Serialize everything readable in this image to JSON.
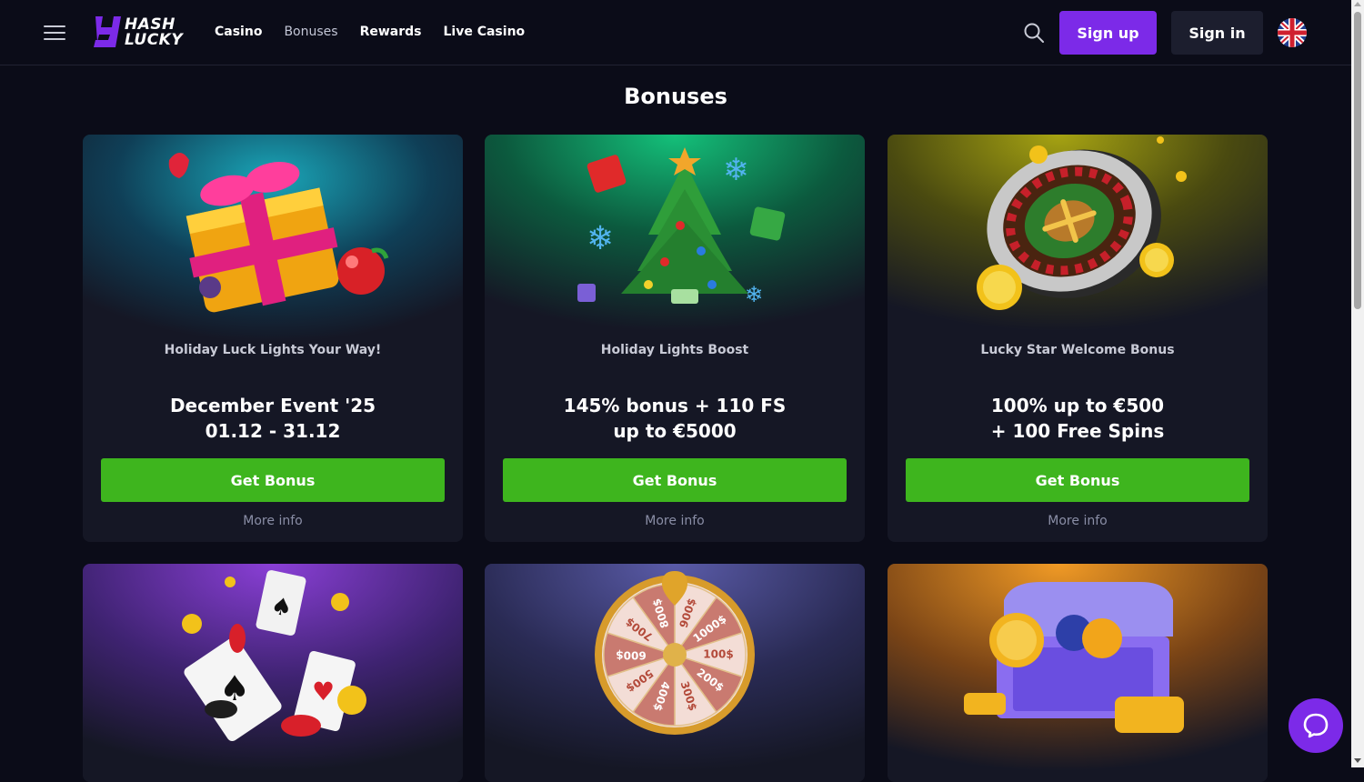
{
  "header": {
    "logo_line1": "HASH",
    "logo_line2": "LUCKY",
    "nav": [
      "Casino",
      "Bonuses",
      "Rewards",
      "Live Casino"
    ],
    "signup_label": "Sign up",
    "signin_label": "Sign in"
  },
  "page_title": "Bonuses",
  "cards": [
    {
      "subtitle": "Holiday Luck Lights Your Way!",
      "title_line1": "December Event '25",
      "title_line2": "01.12 - 31.12",
      "button": "Get Bonus",
      "more": "More info",
      "art": "gift-box"
    },
    {
      "subtitle": "Holiday Lights Boost",
      "title_line1": "145% bonus + 110 FS",
      "title_line2": "up to €5000",
      "button": "Get Bonus",
      "more": "More info",
      "art": "christmas-tree"
    },
    {
      "subtitle": "Lucky Star Welcome Bonus",
      "title_line1": "100% up to €500",
      "title_line2": "+ 100 Free Spins",
      "button": "Get Bonus",
      "more": "More info",
      "art": "roulette-wheel"
    },
    {
      "art": "playing-cards"
    },
    {
      "art": "prize-wheel",
      "wheel_labels": [
        "900$",
        "1000$",
        "100$",
        "200$",
        "300$",
        "400$",
        "500$",
        "600$",
        "700$",
        "800$"
      ]
    },
    {
      "art": "treasure-chest"
    }
  ],
  "colors": {
    "background": "#0b0c18",
    "card": "#151725",
    "accent_purple": "#7c2ae8",
    "button_green": "#3eb51e"
  }
}
